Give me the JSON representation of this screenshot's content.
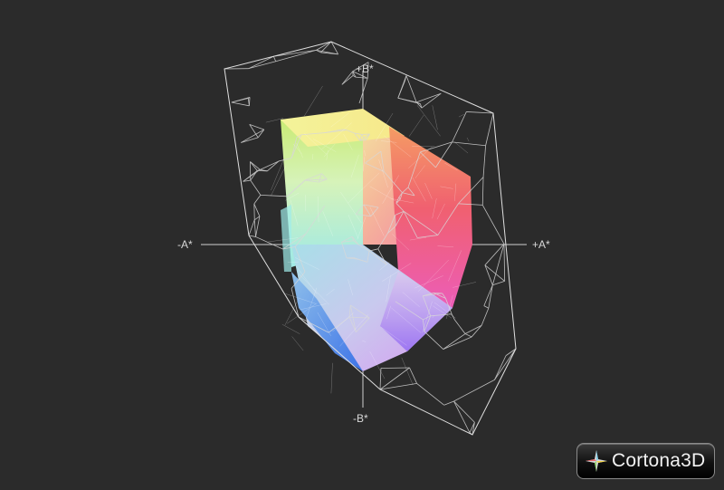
{
  "axes": {
    "plus_b": "+B*",
    "minus_a": "-A*",
    "plus_a": "+A*",
    "minus_b": "-B*"
  },
  "logo": {
    "text": "Cortona3D",
    "icon": "cortona-star-icon"
  },
  "colors": {
    "background": "#2b2b2b",
    "wireframe": "#d8d8d8",
    "axis": "#cfcfcf"
  }
}
